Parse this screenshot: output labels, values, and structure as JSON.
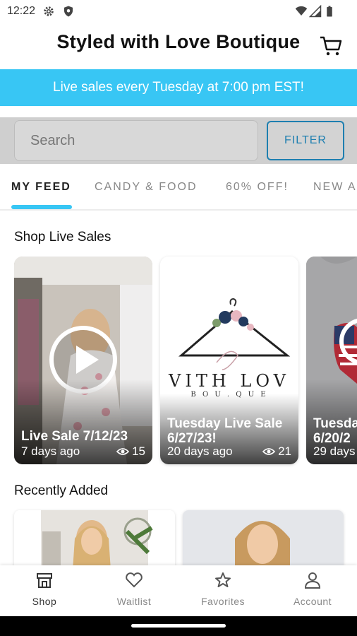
{
  "status": {
    "time": "12:22",
    "icons": [
      "gear-icon",
      "shield-icon",
      "wifi-icon",
      "signal-icon",
      "battery-icon"
    ]
  },
  "header": {
    "title": "Styled with Love Boutique",
    "cart_icon": "cart-icon"
  },
  "banner": {
    "text": "Live sales every Tuesday at 7:00 pm EST!",
    "color": "#38c6f4"
  },
  "search": {
    "placeholder": "Search",
    "filter_label": "FILTER"
  },
  "tabs": [
    {
      "label": "MY FEED"
    },
    {
      "label": "CANDY & FOOD"
    },
    {
      "label": "60% OFF!"
    },
    {
      "label": "NEW A"
    }
  ],
  "live_sales": {
    "title": "Shop Live Sales",
    "cards": [
      {
        "title": "Live Sale 7/12/23",
        "age": "7 days ago",
        "views": "15"
      },
      {
        "title": "Tuesday Live Sale 6/27/23!",
        "age": "20 days ago",
        "views": "21",
        "logo_text": "VITH LOV",
        "logo_sub": "B O U . Q U E"
      },
      {
        "title": "Tuesda 6/20/2",
        "age": "29 days"
      }
    ]
  },
  "recently_added": {
    "title": "Recently Added"
  },
  "bottom_nav": [
    {
      "label": "Shop",
      "icon": "shop-icon"
    },
    {
      "label": "Waitlist",
      "icon": "heart-icon"
    },
    {
      "label": "Favorites",
      "icon": "star-icon"
    },
    {
      "label": "Account",
      "icon": "person-icon"
    }
  ]
}
